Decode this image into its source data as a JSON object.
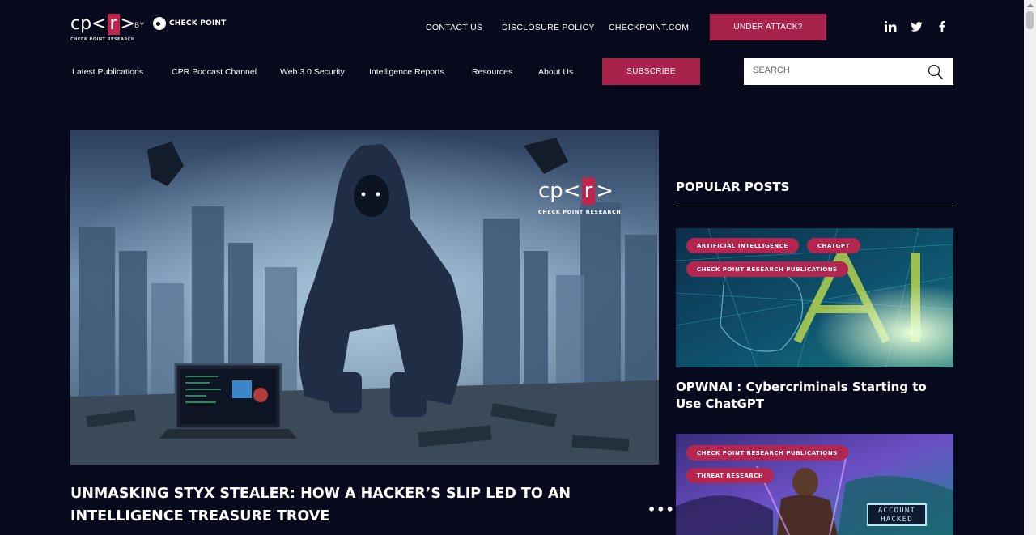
{
  "brand": {
    "logo_left": "cp<",
    "logo_r": "r",
    "logo_right": ">",
    "logo_sub": "CHECK POINT RESEARCH",
    "by": "BY",
    "parent": "CHECK POINT"
  },
  "top_links": [
    "CONTACT US",
    "DISCLOSURE POLICY",
    "CHECKPOINT.COM"
  ],
  "attack_label": "UNDER ATTACK?",
  "social": [
    "linkedin-icon",
    "twitter-icon",
    "facebook-icon"
  ],
  "nav": [
    "Latest Publications",
    "CPR Podcast Channel",
    "Web 3.0 Security",
    "Intelligence Reports",
    "Resources",
    "About Us"
  ],
  "subscribe_label": "SUBSCRIBE",
  "search": {
    "placeholder": "SEARCH"
  },
  "hero": {
    "title": "UNMASKING STYX STEALER: HOW A HACKER’S SLIP LED TO AN INTELLIGENCE TREASURE TROVE",
    "badge_left": "cp<",
    "badge_r": "r",
    "badge_right": ">",
    "badge_sub": "CHECK POINT RESEARCH",
    "more": "•••"
  },
  "popular": {
    "heading": "POPULAR POSTS",
    "posts": [
      {
        "tags": [
          "ARTIFICIAL INTELLIGENCE",
          "CHATGPT",
          "CHECK POINT RESEARCH PUBLICATIONS"
        ],
        "title": "OPWNAI : Cybercriminals Starting to Use ChatGPT"
      },
      {
        "tags": [
          "CHECK POINT RESEARCH PUBLICATIONS",
          "THREAT RESEARCH"
        ],
        "overlay": "ACCOUNT HACKED"
      }
    ]
  },
  "colors": {
    "background": "#070a1c",
    "accent": "#a8234b",
    "tag": "#b3264f"
  }
}
